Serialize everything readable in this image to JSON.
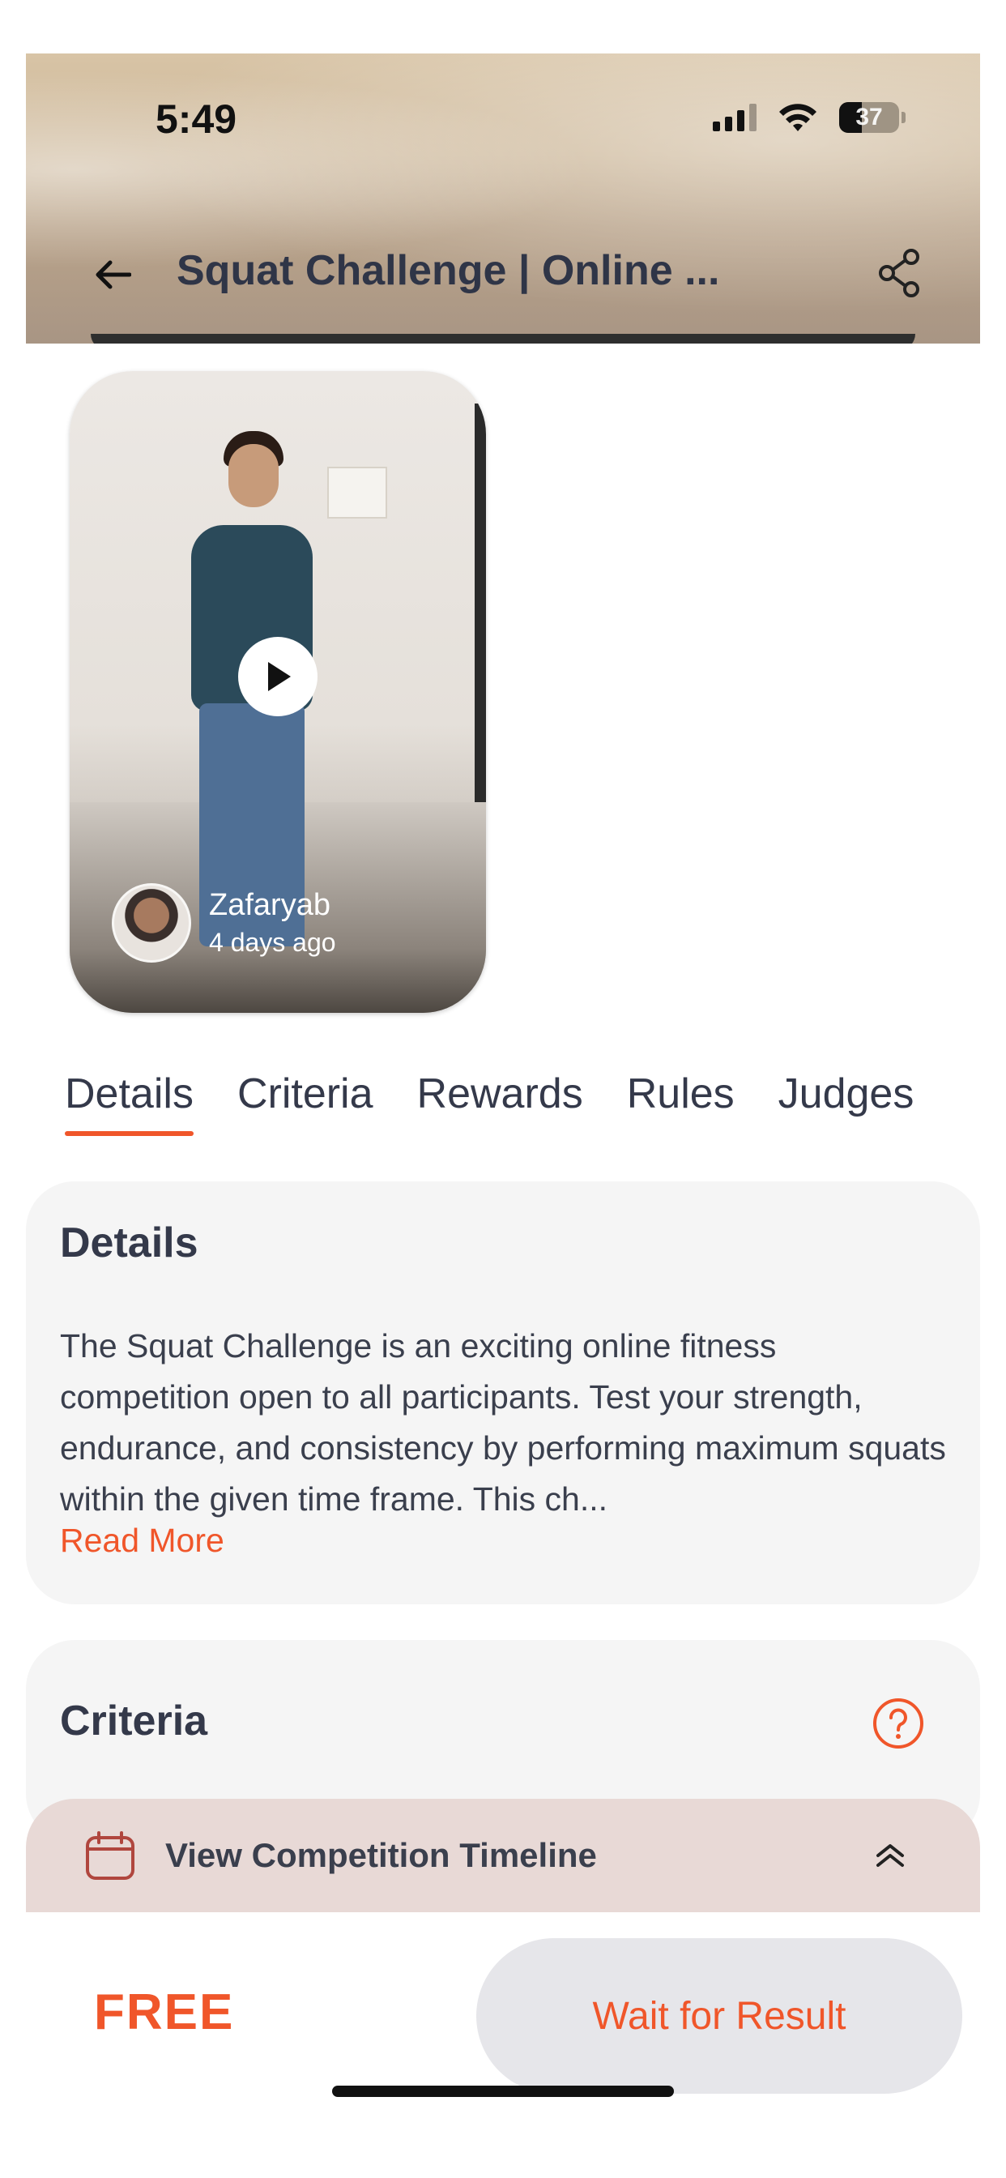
{
  "status_bar": {
    "time": "5:49",
    "battery": "37"
  },
  "header": {
    "title": "Squat Challenge | Online ..."
  },
  "video": {
    "uploader_name": "Zafaryab",
    "uploaded_ago": "4 days ago"
  },
  "tabs": [
    {
      "label": "Details",
      "active": true
    },
    {
      "label": "Criteria",
      "active": false
    },
    {
      "label": "Rewards",
      "active": false
    },
    {
      "label": "Rules",
      "active": false
    },
    {
      "label": "Judges",
      "active": false
    }
  ],
  "details": {
    "title": "Details",
    "text": "The Squat Challenge is an exciting online fitness competition open to all participants. Test your strength, endurance, and consistency by performing maximum squats within the given time frame. This ch...",
    "read_more": "Read More"
  },
  "criteria": {
    "title": "Criteria"
  },
  "timeline": {
    "label": "View Competition Timeline"
  },
  "footer": {
    "price": "FREE",
    "action_label": "Wait for Result"
  },
  "colors": {
    "accent": "#f0562a",
    "text": "#34394a",
    "card": "#f5f5f5",
    "timeline_bg": "#e8d9d6"
  }
}
